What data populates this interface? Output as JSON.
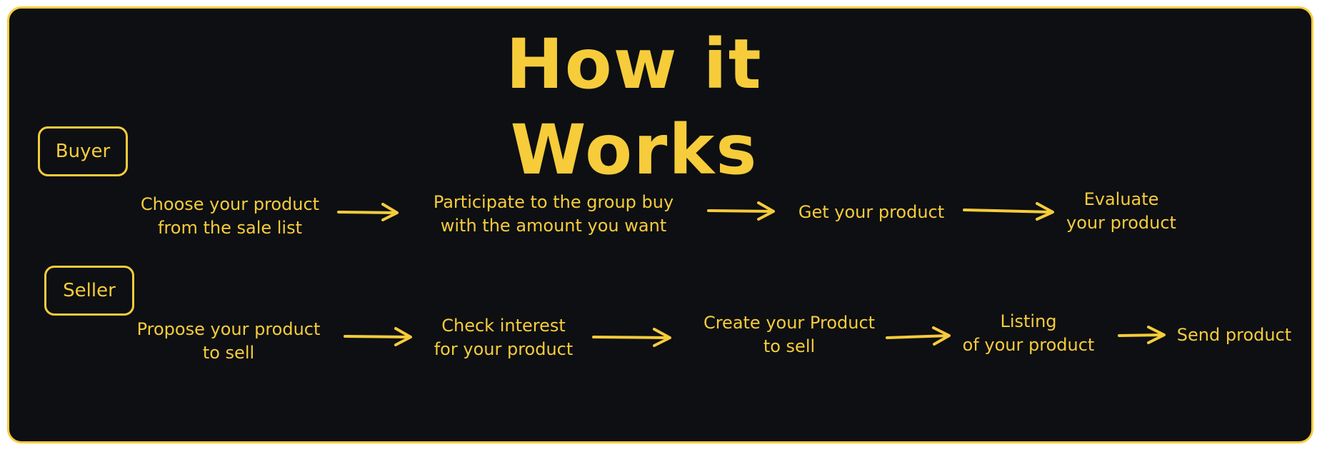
{
  "title": "How it Works",
  "colors": {
    "background": "#0d0f12",
    "accent": "#f6cc3b"
  },
  "buyer": {
    "label": "Buyer",
    "steps": [
      "Choose your product\nfrom the sale list",
      "Participate to the group buy\nwith the amount you want",
      "Get your product",
      "Evaluate\nyour product"
    ]
  },
  "seller": {
    "label": "Seller",
    "steps": [
      "Propose your product\nto sell",
      "Check interest\nfor your product",
      "Create your Product\nto sell",
      "Listing\nof your product",
      "Send product"
    ]
  }
}
